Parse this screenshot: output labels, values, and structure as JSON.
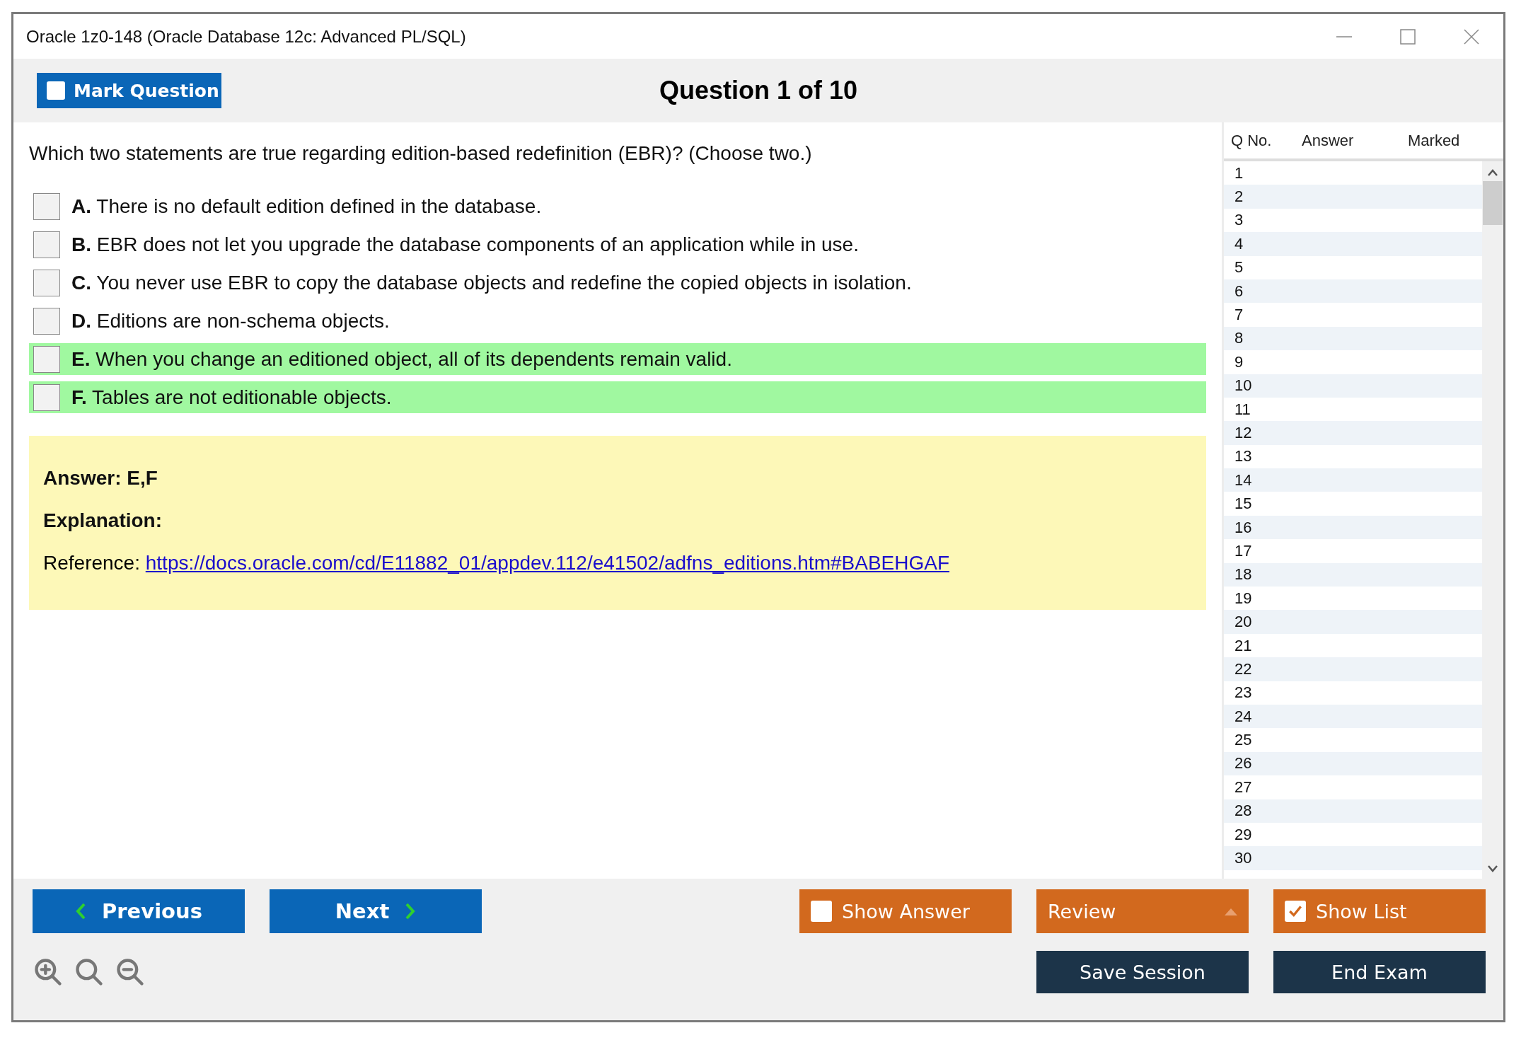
{
  "window": {
    "title": "Oracle 1z0-148 (Oracle Database 12c: Advanced PL/SQL)"
  },
  "toolbar": {
    "mark_question": {
      "label": "Mark Question",
      "checked": false
    },
    "heading": "Question 1 of 10"
  },
  "question": {
    "text": "Which two statements are true regarding edition-based redefinition (EBR)? (Choose two.)",
    "options": [
      {
        "letter": "A.",
        "text": "There is no default edition defined in the database.",
        "checked": false,
        "correct": false
      },
      {
        "letter": "B.",
        "text": "EBR does not let you upgrade the database components of an application while in use.",
        "checked": false,
        "correct": false
      },
      {
        "letter": "C.",
        "text": "You never use EBR to copy the database objects and redefine the copied objects in isolation.",
        "checked": false,
        "correct": false
      },
      {
        "letter": "D.",
        "text": "Editions are non-schema objects.",
        "checked": false,
        "correct": false
      },
      {
        "letter": "E.",
        "text": "When you change an editioned object, all of its dependents remain valid.",
        "checked": false,
        "correct": true
      },
      {
        "letter": "F.",
        "text": "Tables are not editionable objects.",
        "checked": false,
        "correct": true
      }
    ]
  },
  "answer_panel": {
    "answer": "Answer: E,F",
    "explanation": "Explanation:",
    "reference_label": "Reference: ",
    "reference_link": "https://docs.oracle.com/cd/E11882_01/appdev.112/e41502/adfns_editions.htm#BABEHGAF"
  },
  "question_list": {
    "columns": [
      "Q No.",
      "Answer",
      "Marked"
    ],
    "rows": [
      "1",
      "2",
      "3",
      "4",
      "5",
      "6",
      "7",
      "8",
      "9",
      "10",
      "11",
      "12",
      "13",
      "14",
      "15",
      "16",
      "17",
      "18",
      "19",
      "20",
      "21",
      "22",
      "23",
      "24",
      "25",
      "26",
      "27",
      "28",
      "29",
      "30"
    ]
  },
  "footer": {
    "previous": "Previous",
    "next": "Next",
    "show_answer": {
      "label": "Show Answer",
      "checked": false
    },
    "review": "Review",
    "show_list": {
      "label": "Show List",
      "checked": true
    },
    "save_session": "Save Session",
    "end_exam": "End Exam"
  }
}
